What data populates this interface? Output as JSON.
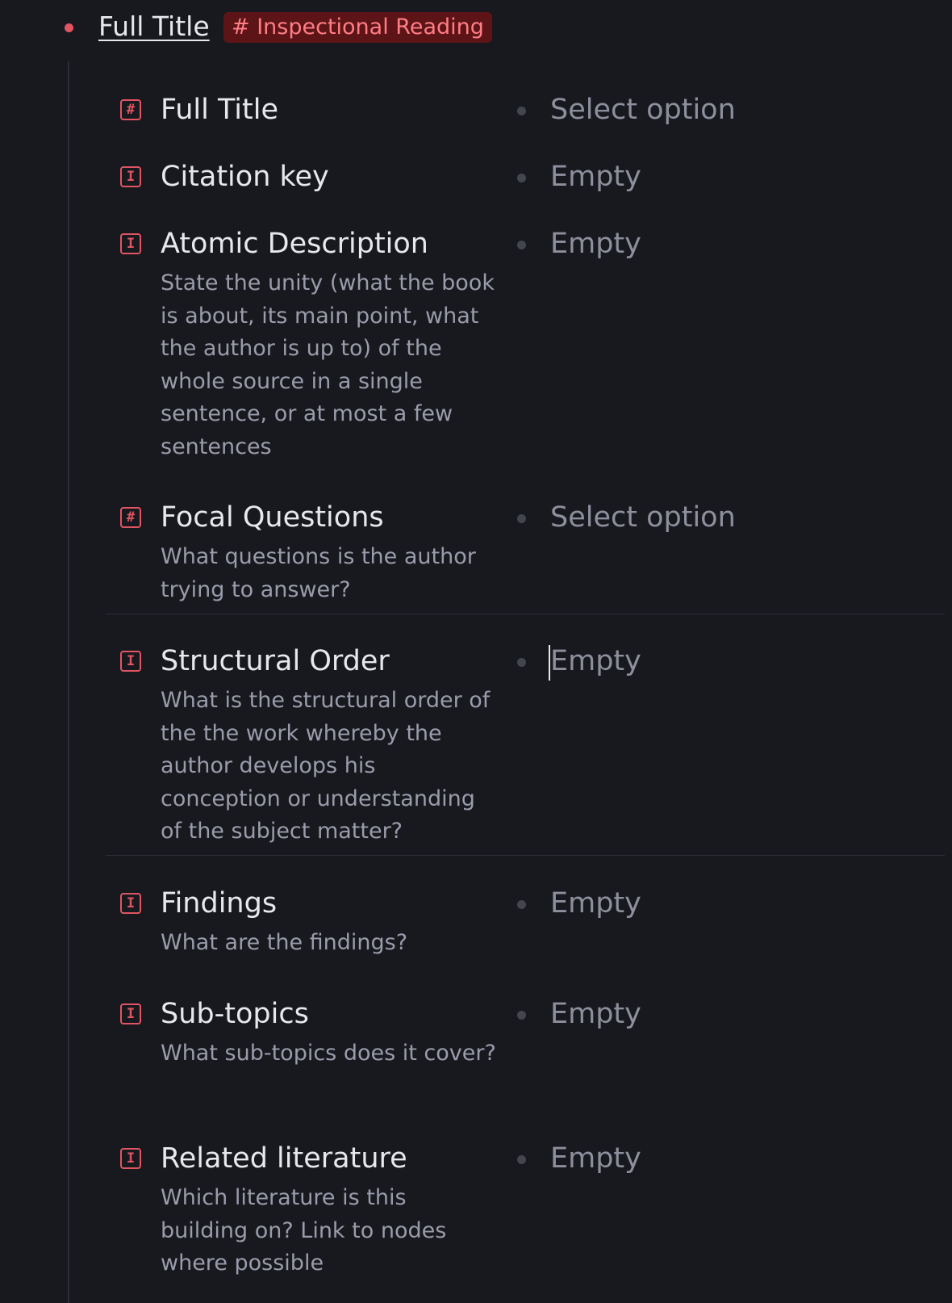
{
  "node": {
    "title": "Full Title",
    "tag": "# Inspectional Reading"
  },
  "fields": [
    {
      "icon": "#",
      "name": "Full Title",
      "description": "",
      "value": "Select option"
    },
    {
      "icon": "I",
      "name": "Citation key",
      "description": "",
      "value": "Empty"
    },
    {
      "icon": "I",
      "name": "Atomic Description",
      "description": "State the unity (what the book is about, its main point, what the author is up to) of the whole source in a single sentence, or at most a few sentences",
      "value": "Empty"
    },
    {
      "icon": "#",
      "name": "Focal Questions",
      "description": "What questions is the author trying to answer?",
      "value": "Select option"
    },
    {
      "icon": "I",
      "name": "Structural Order",
      "description": "What is the structural order of the the work whereby the author develops his conception or understanding of the subject matter?",
      "value": "Empty"
    },
    {
      "icon": "I",
      "name": "Findings",
      "description": "What are the findings?",
      "value": "Empty"
    },
    {
      "icon": "I",
      "name": "Sub-topics",
      "description": "What sub-topics does it cover?",
      "value": "Empty"
    },
    {
      "icon": "I",
      "name": "Related literature",
      "description": "Which literature is this building on? Link to nodes where possible",
      "value": "Empty"
    }
  ],
  "colors": {
    "background": "#18191f",
    "accent": "#e05561",
    "tag_background": "#5c1417",
    "tag_text": "#ff7d85"
  }
}
